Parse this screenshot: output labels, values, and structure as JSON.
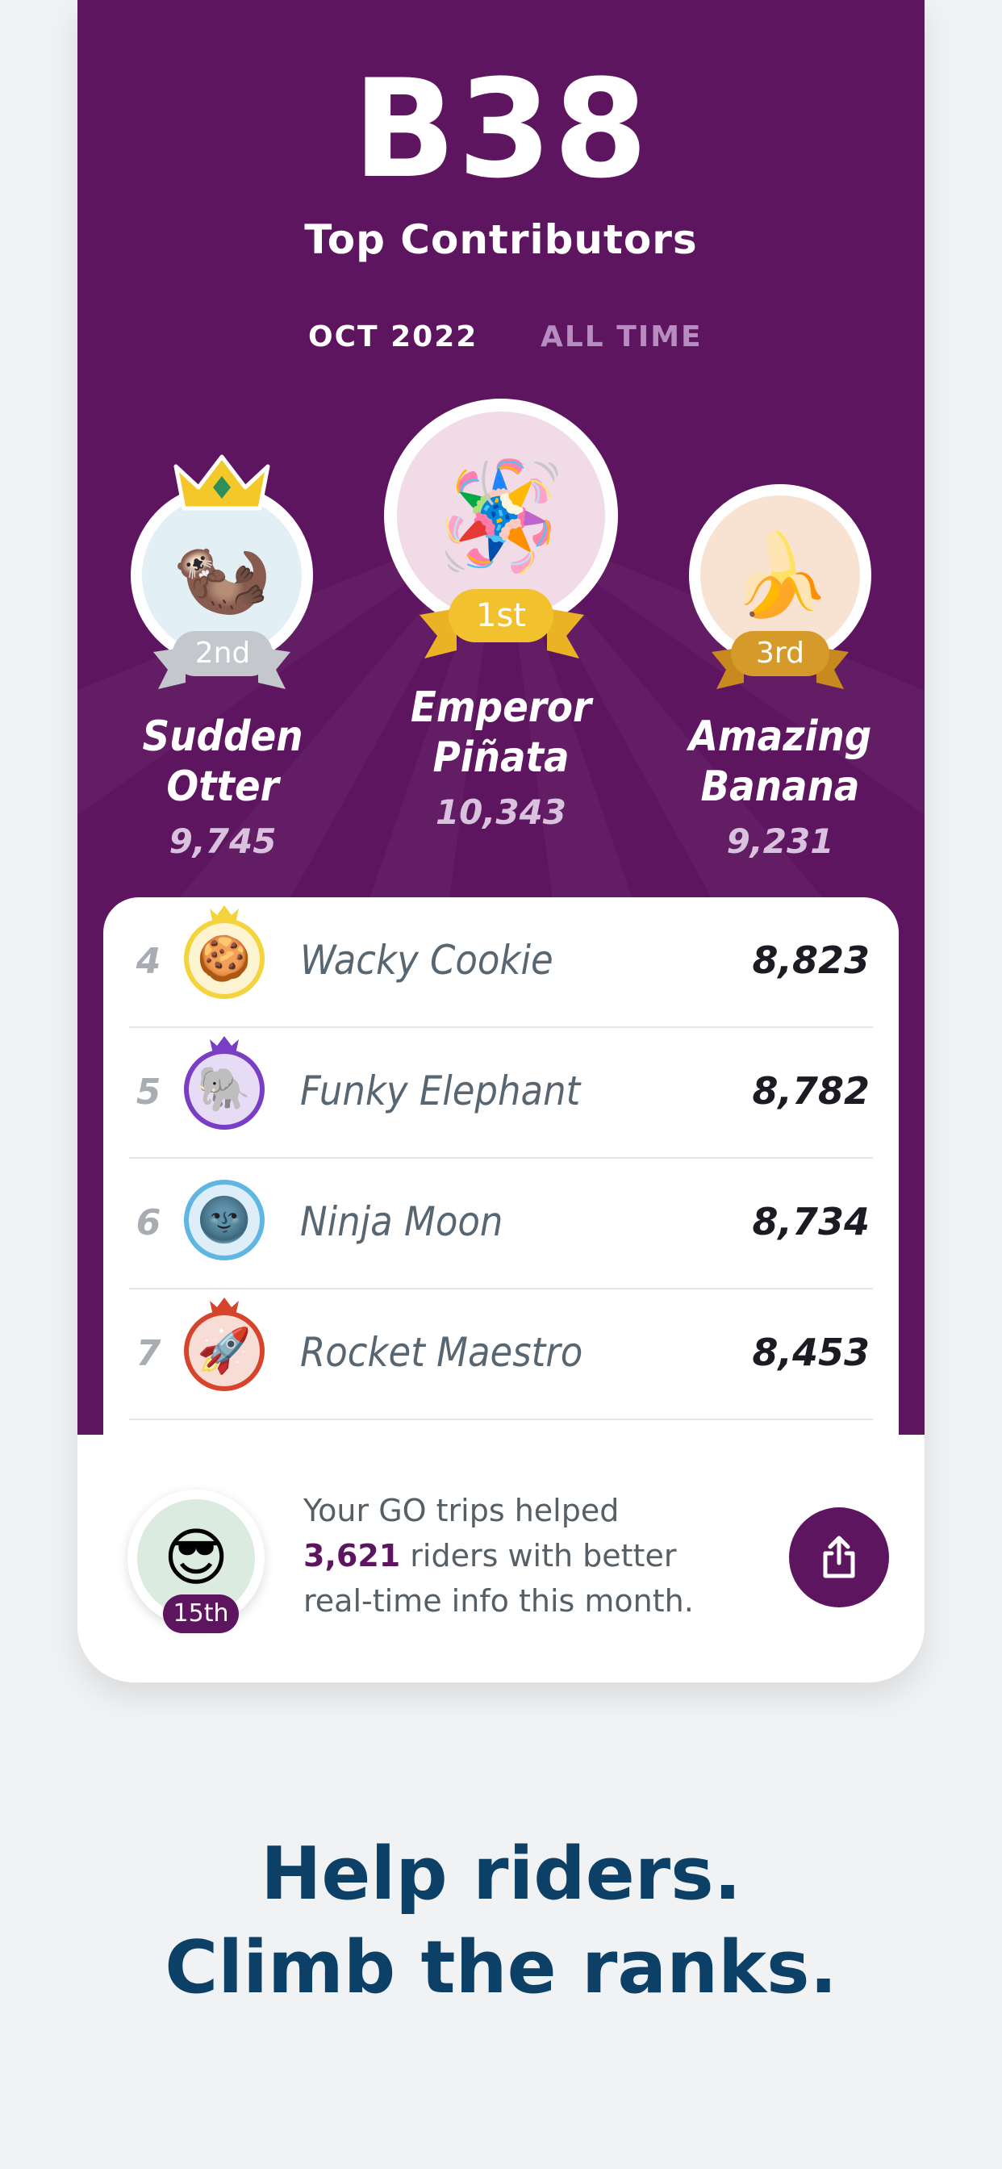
{
  "header": {
    "route": "B38",
    "title": "Top Contributors",
    "tabs": [
      {
        "label": "OCT 2022",
        "active": true
      },
      {
        "label": "ALL TIME",
        "active": false
      }
    ]
  },
  "podium": [
    {
      "position": "1st",
      "name_line1": "Emperor",
      "name_line2": "Piñata",
      "score": "10,343",
      "emoji": "🪅",
      "icon": "pinata-icon",
      "bg": "#f0dbe6",
      "medal": "#f2c12e"
    },
    {
      "position": "2nd",
      "name_line1": "Sudden",
      "name_line2": "Otter",
      "score": "9,745",
      "emoji": "🦦",
      "icon": "otter-icon",
      "bg": "#e2eff5",
      "medal": "#c4c7cb",
      "crown": true
    },
    {
      "position": "3rd",
      "name_line1": "Amazing",
      "name_line2": "Banana",
      "score": "9,231",
      "emoji": "🍌",
      "icon": "banana-icon",
      "bg": "#f8e2d2",
      "medal": "#d59a2a"
    }
  ],
  "leaderboard": [
    {
      "rank": "4",
      "name": "Wacky Cookie",
      "score": "8,823",
      "emoji": "🍪",
      "icon": "cookie-icon",
      "ring": "#f3d43c",
      "crown": "#f3d43c"
    },
    {
      "rank": "5",
      "name": "Funky Elephant",
      "score": "8,782",
      "emoji": "🐘",
      "icon": "elephant-icon",
      "ring": "#7a3ec6",
      "crown": "#7a3ec6"
    },
    {
      "rank": "6",
      "name": "Ninja Moon",
      "score": "8,734",
      "emoji": "🌚",
      "icon": "moon-icon",
      "ring": "#5fb6e2",
      "crown": null
    },
    {
      "rank": "7",
      "name": "Rocket Maestro",
      "score": "8,453",
      "emoji": "🚀",
      "icon": "rocket-icon",
      "ring": "#d6452b",
      "crown": "#d6452b"
    }
  ],
  "footer": {
    "my_rank": "15th",
    "my_emoji": "😎",
    "line1": "Your GO trips helped",
    "highlight": "3,621",
    "line2_rest": " riders with better",
    "line3": "real-time info this month."
  },
  "tagline": {
    "line1": "Help riders.",
    "line2": "Climb the ranks."
  },
  "colors": {
    "purple": "#5e1560",
    "navy": "#0c4066",
    "gold": "#f2c12e",
    "silver": "#c4c7cb",
    "bronze": "#d59a2a"
  }
}
